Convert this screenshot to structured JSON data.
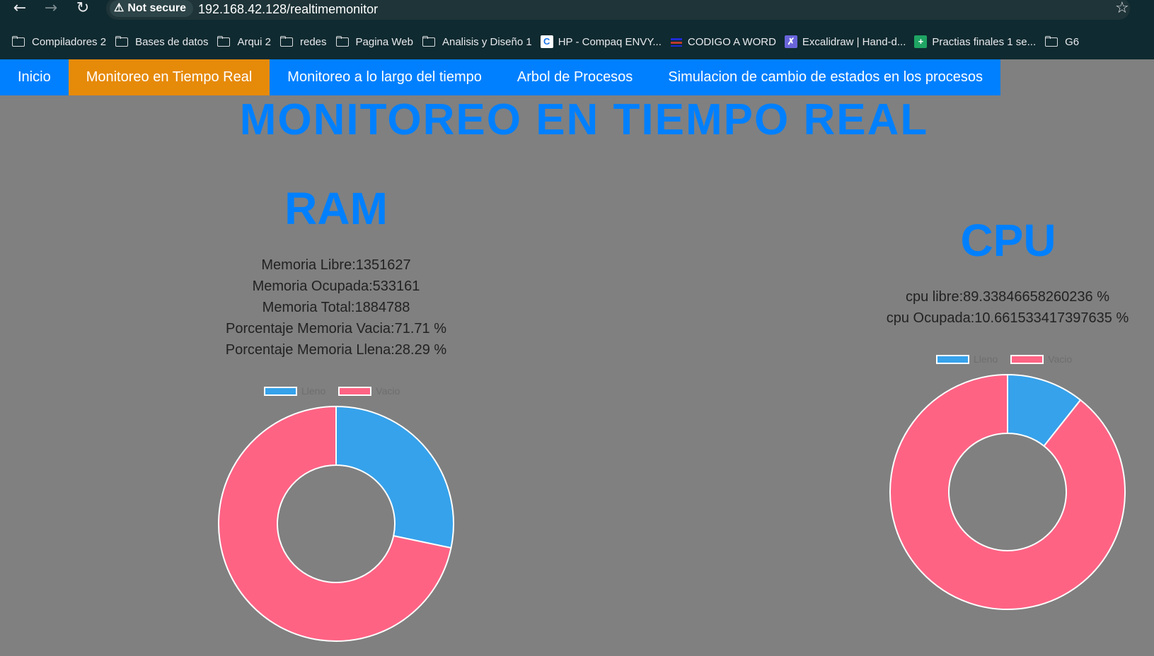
{
  "browser": {
    "security_label": "Not secure",
    "url": "192.168.42.128/realtimemonitor",
    "bookmarks": [
      {
        "label": "Compiladores 2",
        "icon": "folder-icon"
      },
      {
        "label": "Bases de datos",
        "icon": "folder-icon"
      },
      {
        "label": "Arqui 2",
        "icon": "folder-icon"
      },
      {
        "label": "redes",
        "icon": "folder-icon"
      },
      {
        "label": "Pagina Web",
        "icon": "folder-icon"
      },
      {
        "label": "Analisis y Diseño 1",
        "icon": "folder-icon"
      },
      {
        "label": "HP - Compaq ENVY...",
        "icon": "c-site-icon"
      },
      {
        "label": "CODIGO A WORD",
        "icon": "word-site-icon"
      },
      {
        "label": "Excalidraw | Hand-d...",
        "icon": "excalidraw-icon"
      },
      {
        "label": "Practias finales 1 se...",
        "icon": "sheets-icon"
      },
      {
        "label": "G6",
        "icon": "folder-icon"
      }
    ]
  },
  "nav": {
    "items": [
      {
        "label": "Inicio"
      },
      {
        "label": "Monitoreo en Tiempo Real",
        "active": true
      },
      {
        "label": "Monitoreo a lo largo del tiempo"
      },
      {
        "label": "Arbol de Procesos"
      },
      {
        "label": "Simulacion de cambio de estados en los procesos"
      }
    ],
    "bar_color": "#0080ff",
    "active_color": "#e68a09"
  },
  "page": {
    "title": "MONITOREO EN TIEMPO REAL"
  },
  "ram": {
    "title": "RAM",
    "stats": [
      "Memoria Libre:1351627",
      "Memoria Ocupada:533161",
      "Memoria Total:1884788",
      "Porcentaje Memoria Vacia:71.71 %",
      "Porcentaje Memoria Llena:28.29 %"
    ]
  },
  "cpu": {
    "title": "CPU",
    "stats": [
      "cpu libre:89.33846658260236 %",
      "cpu Ocupada:10.661533417397635 %"
    ]
  },
  "chart_data": [
    {
      "type": "pie",
      "categories": [
        "Lleno",
        "Vacio"
      ],
      "values": [
        28.29,
        71.71
      ],
      "colors": [
        "#36a2eb",
        "#ff6384"
      ],
      "legend": "top"
    },
    {
      "type": "pie",
      "categories": [
        "Lleno",
        "Vacio"
      ],
      "values": [
        10.661533417397635,
        89.33846658260236
      ],
      "colors": [
        "#36a2eb",
        "#ff6384"
      ],
      "legend": "top"
    }
  ]
}
